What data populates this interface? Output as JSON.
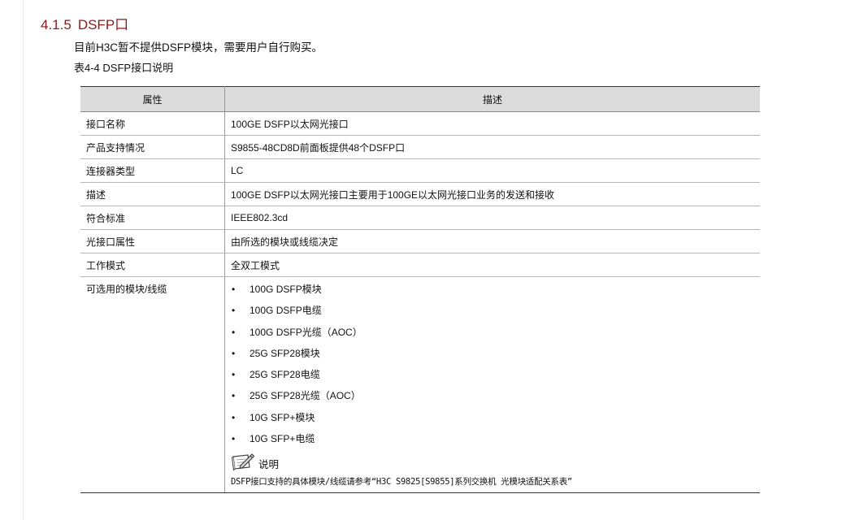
{
  "section": {
    "number": "4.1.5",
    "title": "DSFP口"
  },
  "intro": "目前H3C暂不提供DSFP模块，需要用户自行购买。",
  "table_caption": "表4-4 DSFP接口说明",
  "table": {
    "headers": [
      "属性",
      "描述"
    ],
    "rows": [
      {
        "attr": "接口名称",
        "desc": "100GE DSFP以太网光接口"
      },
      {
        "attr": "产品支持情况",
        "desc": "S9855-48CD8D前面板提供48个DSFP口"
      },
      {
        "attr": "连接器类型",
        "desc": "LC"
      },
      {
        "attr": "描述",
        "desc": "100GE DSFP以太网光接口主要用于100GE以太网光接口业务的发送和接收"
      },
      {
        "attr": "符合标准",
        "desc": "IEEE802.3cd"
      },
      {
        "attr": "光接口属性",
        "desc": "由所选的模块或线缆决定"
      },
      {
        "attr": "工作模式",
        "desc": "全双工模式"
      }
    ],
    "options_row": {
      "attr": "可选用的模块/线缆",
      "bullet": "•",
      "items": [
        "100G DSFP模块",
        "100G DSFP电缆",
        "100G DSFP光缆（AOC）",
        "25G SFP28模块",
        "25G SFP28电缆",
        "25G SFP28光缆（AOC）",
        "10G SFP+模块",
        "10G SFP+电缆"
      ],
      "note_icon": "note-pencil-icon",
      "note_label": "说明",
      "note_text": "DSFP接口支持的具体模块/线缆请参考“H3C S9825[S9855]系列交换机 光模块适配关系表”"
    }
  },
  "colors": {
    "heading": "#8b1a1a",
    "header_bg": "#dcdcdc",
    "text": "#111111"
  }
}
